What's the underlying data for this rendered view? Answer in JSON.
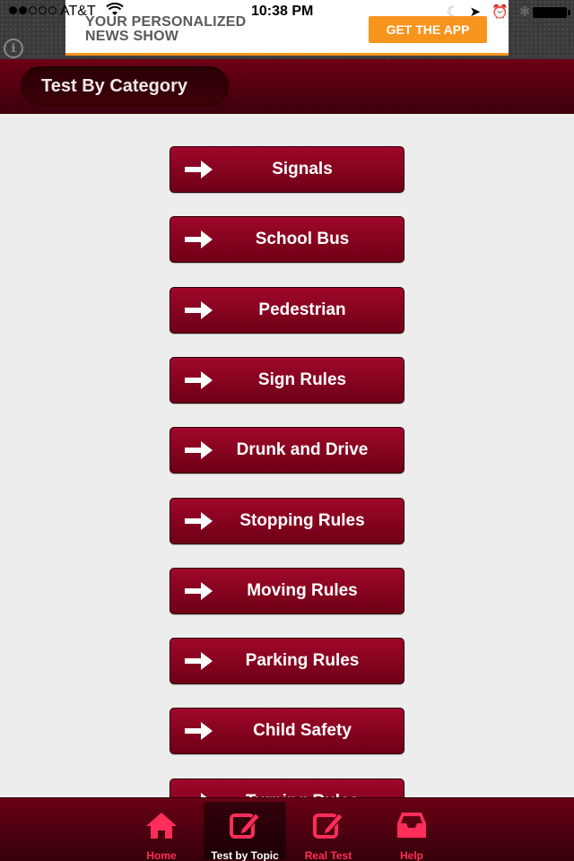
{
  "status_bar": {
    "carrier": "AT&T",
    "time": "10:38 PM",
    "signal_bars_filled": 2,
    "signal_bars_total": 5
  },
  "ad": {
    "headline_line1": "YOUR PERSONALIZED",
    "headline_line2": "NEWS SHOW",
    "cta": "GET THE APP",
    "info": "i"
  },
  "header": {
    "title": "Test By Category"
  },
  "categories": [
    {
      "label": "Signals"
    },
    {
      "label": "School Bus"
    },
    {
      "label": "Pedestrian"
    },
    {
      "label": "Sign Rules"
    },
    {
      "label": "Drunk and Drive"
    },
    {
      "label": "Stopping Rules"
    },
    {
      "label": "Moving Rules"
    },
    {
      "label": "Parking Rules"
    },
    {
      "label": "Child Safety"
    },
    {
      "label": "Turning Rules"
    }
  ],
  "tabs": [
    {
      "label": "Home",
      "icon": "home-icon",
      "active": false
    },
    {
      "label": "Test by Topic",
      "icon": "edit-icon",
      "active": true
    },
    {
      "label": "Real Test",
      "icon": "edit-icon",
      "active": false
    },
    {
      "label": "Help",
      "icon": "inbox-icon",
      "active": false
    }
  ],
  "colors": {
    "accent": "#ff2d5a",
    "button_top": "#a0072a",
    "button_bottom": "#6e0016",
    "ad_orange": "#f7941d"
  }
}
